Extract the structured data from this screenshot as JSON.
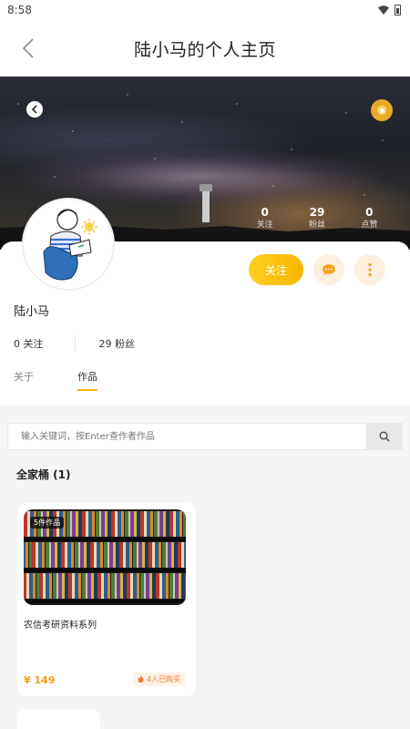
{
  "status_bar": {
    "time": "8:58"
  },
  "nav": {
    "title": "陆小马的个人主页"
  },
  "banner": {
    "stats": [
      {
        "value": "0",
        "label": "关注"
      },
      {
        "value": "29",
        "label": "粉丝"
      },
      {
        "value": "0",
        "label": "点赞"
      }
    ]
  },
  "actions": {
    "follow_label": "关注"
  },
  "profile": {
    "username": "陆小马",
    "following_text": "0 关注",
    "followers_text": "29 粉丝"
  },
  "tabs": [
    {
      "label": "关于",
      "active": false
    },
    {
      "label": "作品",
      "active": true
    }
  ],
  "search": {
    "placeholder": "输入关键词，按Enter查作者作品"
  },
  "section": {
    "title": "全家桶 (1)"
  },
  "products": [
    {
      "badge": "5件作品",
      "title": "农信考研资料系列",
      "price": "¥ 149",
      "purchased": "4人已购买"
    }
  ],
  "colors": {
    "accent": "#f7b500",
    "price": "#f39a1e"
  }
}
